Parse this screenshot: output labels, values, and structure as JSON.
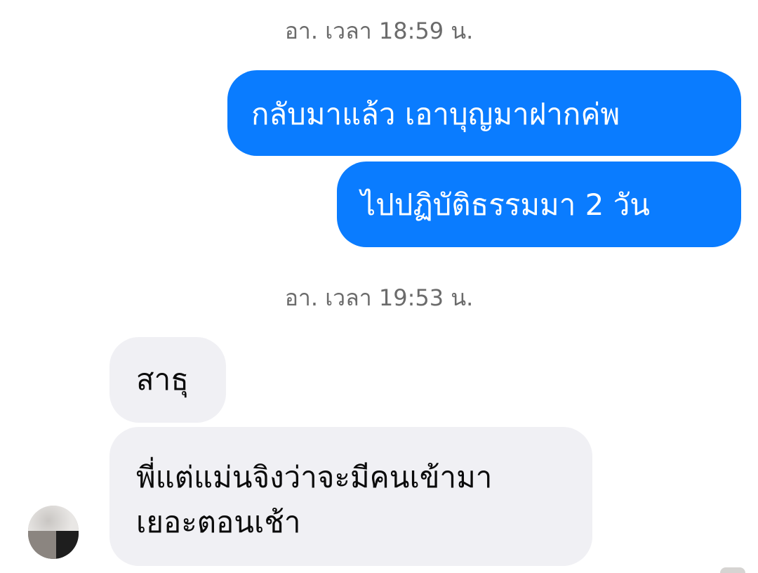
{
  "conversation": {
    "groups": [
      {
        "timestamp": "อา. เวลา 18:59 น.",
        "messages": [
          {
            "direction": "sent",
            "text": "กลับมาแล้ว เอาบุญมาฝากค่พ"
          },
          {
            "direction": "sent",
            "text": "ไปปฏิบัติธรรมมา 2 วัน"
          }
        ]
      },
      {
        "timestamp": "อา. เวลา 19:53 น.",
        "messages": [
          {
            "direction": "received",
            "text": "สาธุ"
          },
          {
            "direction": "received",
            "text": "พี่แต่แม่นจิงว่าจะมีคนเข้ามา\nเยอะตอนเช้า"
          }
        ]
      }
    ]
  },
  "colors": {
    "sent_bubble": "#0a7cff",
    "received_bubble": "#f0f0f4",
    "timestamp_text": "#6b6b6b"
  },
  "icons": {
    "contact_avatar": "avatar-icon"
  }
}
